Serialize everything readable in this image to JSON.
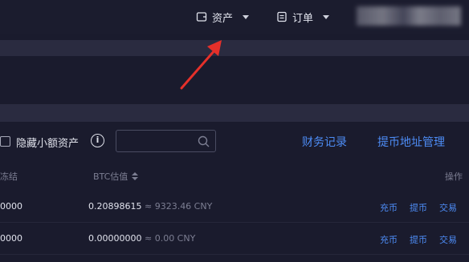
{
  "nav": {
    "assets_label": "资产",
    "orders_label": "订单"
  },
  "filters": {
    "hide_small_label": "隐藏小额资产",
    "info_glyph": "i",
    "search_value": "",
    "finance_record_link": "财务记录",
    "withdraw_address_link": "提币地址管理"
  },
  "table": {
    "columns": {
      "frozen": "冻结",
      "btc_value": "BTC估值",
      "actions": "操作"
    },
    "rows": [
      {
        "frozen": "0000",
        "btc": "0.20898615",
        "cny": "≈ 9323.46 CNY",
        "actions": [
          "充币",
          "提币",
          "交易"
        ]
      },
      {
        "frozen": "0000",
        "btc": "0.00000000",
        "cny": "≈ 0.00 CNY",
        "actions": [
          "充币",
          "提币",
          "交易"
        ]
      }
    ]
  },
  "colors": {
    "background": "#1a1b2d",
    "band": "#2a2b40",
    "link": "#4d8cf5",
    "annotation_arrow": "#e5302a"
  }
}
